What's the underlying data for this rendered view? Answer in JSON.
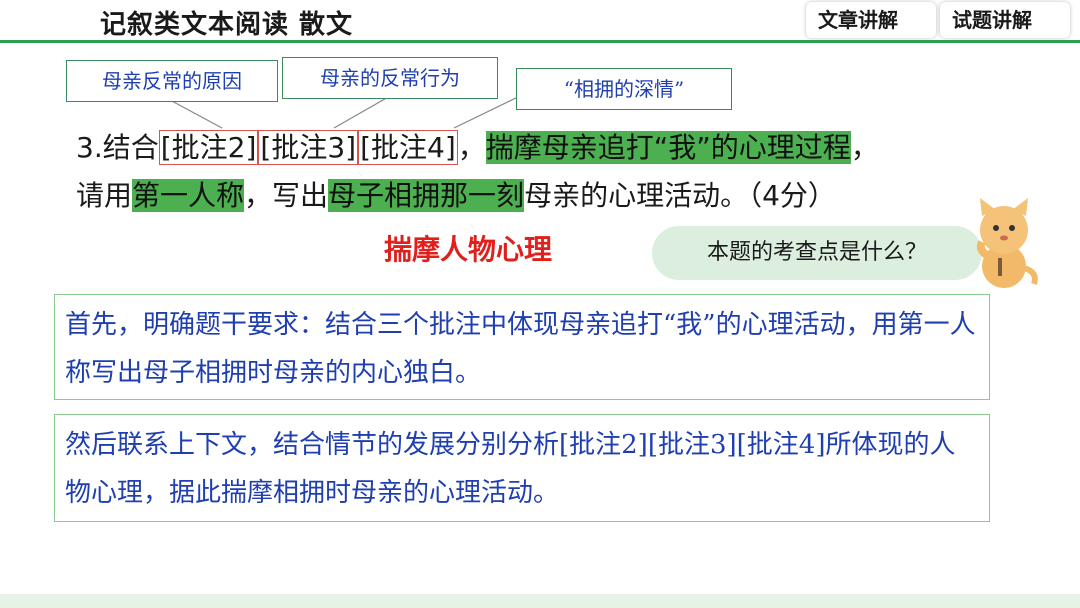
{
  "header": {
    "title": "记叙类文本阅读  散文",
    "tabs": [
      "文章讲解",
      "试题讲解"
    ]
  },
  "labels": [
    "母亲反常的原因",
    "母亲的反常行为",
    "“相拥的深情”"
  ],
  "question": {
    "num": "3.",
    "pre": "结合",
    "ann1": "[批注2]",
    "ann2": "[批注3]",
    "ann3": "[批注4]",
    "comma1": "，",
    "hl1": "揣摩母亲追打“我”的心理过程",
    "comma2": "，",
    "line2_pre": "请用",
    "hl2": "第一人称",
    "mid": "，写出",
    "hl3": "母子相拥那一刻",
    "post": "母亲的心理活动。（4分）"
  },
  "subtitle": "揣摩人物心理",
  "bubble": "本题的考查点是什么？",
  "notes": [
    "首先，明确题干要求：结合三个批注中体现母亲追打“我”的心理活动，用第一人称写出母子相拥时母亲的内心独白。",
    "然后联系上下文，结合情节的发展分别分析[批注2][批注3][批注4]所体现的人物心理，据此揣摩相拥时母亲的心理活动。"
  ],
  "colors": {
    "accent_green": "#2e9e55",
    "highlight_green": "#4caf50",
    "title_red": "#e0201c",
    "text_blue": "#1f3fb0"
  },
  "icons": [
    "cat-mascot-icon"
  ]
}
